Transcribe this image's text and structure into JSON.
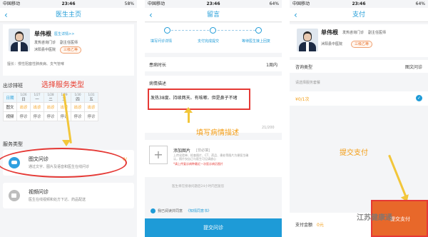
{
  "status": {
    "carrier": "中国移动",
    "time1": "23:46",
    "time2": "23:46",
    "time3": "23:46",
    "battery1": "58%",
    "battery2": "64%",
    "battery3": "64%"
  },
  "screen1": {
    "title": "医生主页",
    "doctor_name": "单伟根",
    "doctor_link": "医生详情>>",
    "doctor_dept": "发热咨询门诊",
    "doctor_rank": "副主任医师",
    "hospital": "沭阳县中医院",
    "badge": "三级乙等",
    "specialty": "擅长：慢性阻塞性肺疾病、支气管哮",
    "schedule_title": "出诊排班",
    "annotation": "选择服务类型",
    "schedule": {
      "header_row_label": "日期",
      "dates": [
        "1/26",
        "1/27",
        "1/28",
        "1/29",
        "1/30",
        "1/31"
      ],
      "weekdays": [
        "日",
        "一",
        "二",
        "三",
        "四",
        "五"
      ],
      "rows": [
        {
          "label": "图文",
          "cells": [
            "出诊",
            "出诊",
            "出诊",
            "出诊",
            "出诊",
            "出诊"
          ]
        },
        {
          "label": "视频",
          "cells": [
            "停诊",
            "停诊",
            "停诊",
            "停诊",
            "停诊",
            "停诊"
          ]
        }
      ]
    },
    "service_type_title": "服务类型",
    "services": [
      {
        "title": "图文问诊",
        "desc": "通过文字、图片及语音和医生在线问诊",
        "price": "0/"
      },
      {
        "title": "视频问诊",
        "desc": "医生在线视频和处方下达、药品配送",
        "price": ""
      }
    ]
  },
  "screen2": {
    "title": "留言",
    "steps": [
      "填写问诊详情",
      "支付完成提交",
      "等待医生接上回复"
    ],
    "duration_label": "患病时长",
    "duration_value": "1周内",
    "desc_label": "病情描述",
    "desc_text": "发热38度、持续两天、有咳嗽、但是鼻子不堵",
    "annotation": "填写病情描述",
    "counter": "21/200",
    "add_image_label": "添加图片",
    "add_image_optional": "[非必填]",
    "add_image_hint": "上传化验单、检查图片、CT、药品、患处等图片为便医生确认，照片仅自己与医生可见请放心",
    "add_image_warning": "*请上传复诊病种最近一次医诊病历图片",
    "reply_note": "医生将在接收问题后24小时内回复您",
    "agree_text": "我已阅读并同意",
    "agreement_link": "《知情同意书》",
    "submit": "提交问诊"
  },
  "screen3": {
    "title": "支付",
    "doctor_name": "单伟根",
    "doctor_dept": "发热咨询门诊",
    "doctor_rank": "副主任医师",
    "hospital": "沭阳县中医院",
    "badge": "三级乙等",
    "consult_type_label": "咨询类型",
    "consult_type_value": "图文问诊",
    "package_hint": "请选择服务套餐",
    "price_line": "¥0/1次",
    "annotation": "提交支付",
    "total_label": "支付金额",
    "total_value": "0元",
    "pay_button": "提交支付",
    "watermark": "江苏健康通"
  },
  "colors": {
    "primary": "#1e9bd7",
    "annotation_red": "#e83a2c",
    "annotation_orange": "#f39c12",
    "pay_button": "#e8682a"
  }
}
